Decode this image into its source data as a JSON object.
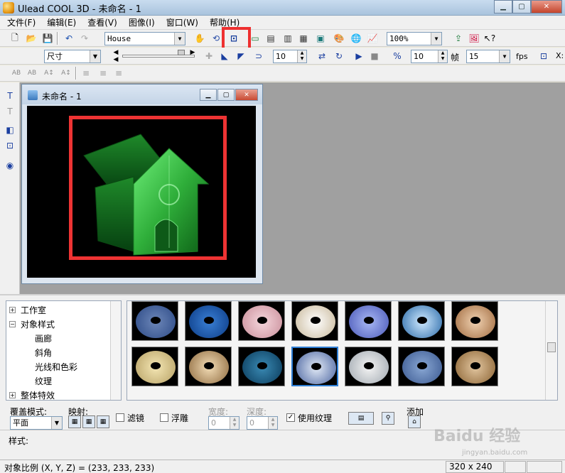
{
  "window": {
    "title": "Ulead COOL 3D - 未命名 - 1"
  },
  "menu": [
    "文件(F)",
    "编辑(E)",
    "查看(V)",
    "图像(I)",
    "窗口(W)",
    "帮助(H)"
  ],
  "toolbar": {
    "object_select": "House",
    "zoom": "100%",
    "unit_select": "尺寸",
    "frame_value": "10",
    "frame_label": "帧",
    "fps_value": "15",
    "fps_label": "fps",
    "step_value": "10",
    "x_label": "X:"
  },
  "child_window": {
    "title": "未命名 - 1"
  },
  "tree": {
    "items": [
      {
        "label": "工作室",
        "expander": "+"
      },
      {
        "label": "对象样式",
        "expander": "−"
      },
      {
        "label": "画廊"
      },
      {
        "label": "斜角"
      },
      {
        "label": "光线和色彩"
      },
      {
        "label": "纹理"
      },
      {
        "label": "整体特效",
        "expander": "+"
      }
    ]
  },
  "options": {
    "overlay_mode_label": "覆盖模式:",
    "overlay_mode_value": "平面",
    "mapping_label": "映射:",
    "filter_label": "滤镜",
    "emboss_label": "浮雕",
    "width_label": "宽度:",
    "width_value": "0",
    "depth_label": "深度:",
    "depth_value": "0",
    "use_texture_label": "使用纹理",
    "add_label": "添加"
  },
  "style_label": "样式:",
  "status": {
    "scale": "对象比例 (X, Y, Z) = (233, 233, 233)",
    "resolution": "320 x 240"
  },
  "watermark": {
    "text": "Baidu 经验",
    "sub": "jingyan.baidu.com"
  },
  "colors": {
    "highlight": "#ee3030",
    "house": "#2fae3a",
    "selection": "#2f7fd6"
  }
}
